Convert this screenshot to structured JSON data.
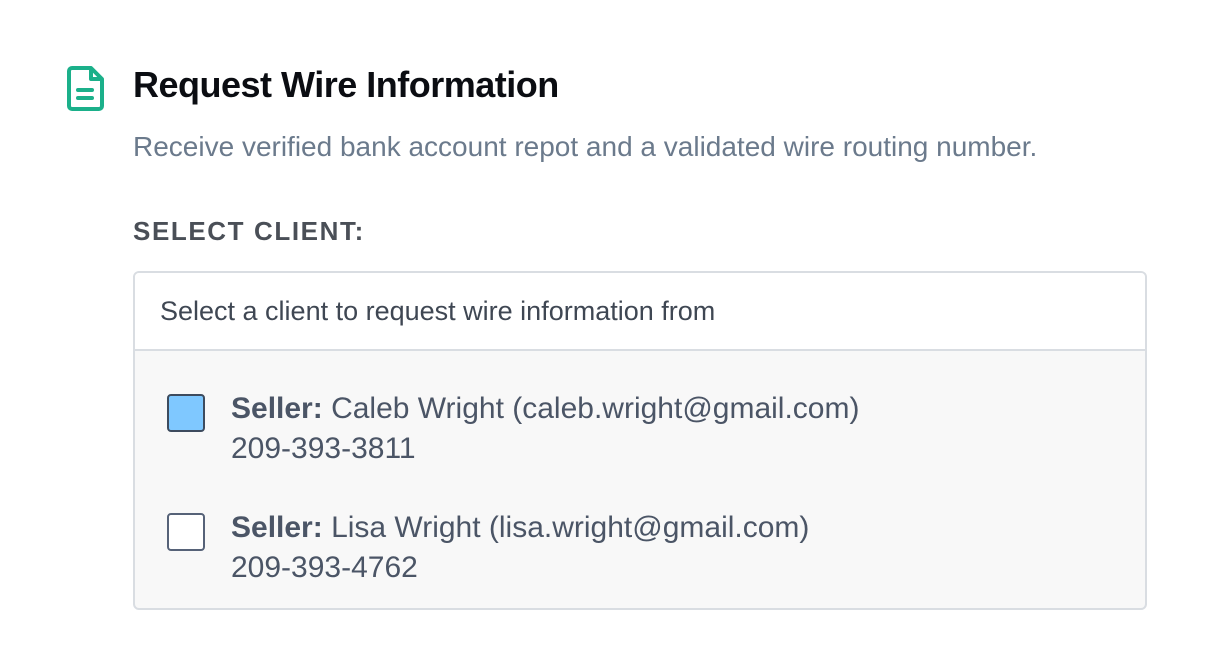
{
  "header": {
    "icon": "document-icon",
    "icon_color": "#1bb08a",
    "title": "Request Wire Information",
    "subtitle": "Receive verified bank account repot and a validated wire routing number."
  },
  "select_client": {
    "label": "SELECT CLIENT:",
    "prompt": "Select a client to request wire information from",
    "clients": [
      {
        "role": "Seller:",
        "name_email": "Caleb Wright (caleb.wright@gmail.com)",
        "phone": "209-393-3811",
        "checked": true
      },
      {
        "role": "Seller:",
        "name_email": "Lisa Wright (lisa.wright@gmail.com)",
        "phone": "209-393-4762",
        "checked": false
      }
    ]
  },
  "colors": {
    "accent": "#1bb08a",
    "checked_fill": "#7fc8ff",
    "subtitle_text": "#6b7a8c"
  }
}
